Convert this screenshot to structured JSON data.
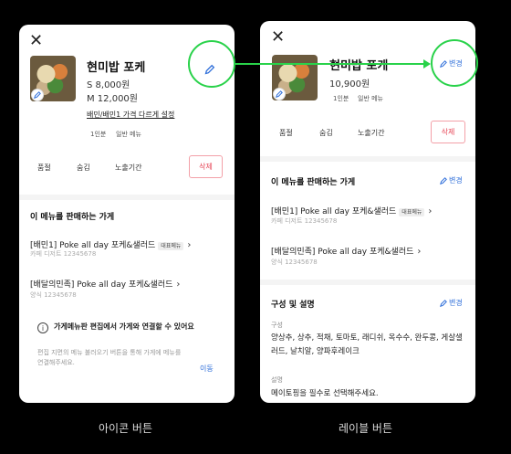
{
  "colors": {
    "background": "#000000",
    "highlight": "#29d24a",
    "delete_accent": "#e64556",
    "edit_blue": "#2b6cd9"
  },
  "left_screen": {
    "close_icon": "✕",
    "menu_name": "현미밥 포케",
    "price_small": "S  8,000원",
    "price_medium": "M  12,000원",
    "price_link": "배민/배민1 가격 다르게 설정",
    "tags": [
      "1인분",
      "일반 메뉴"
    ],
    "tabs": [
      "품절",
      "숨김",
      "노출기간"
    ],
    "delete_label": "삭제",
    "stores_section_title": "이 메뉴를 판매하는 가게",
    "stores": [
      {
        "name": "[배민1] Poke all day 포케&샐러드",
        "badge": "대표메뉴",
        "sub": "카페 디저트 12345678"
      },
      {
        "name": "[배달의민족] Poke all day 포케&샐러드",
        "badge": "",
        "sub": "양식 12345678"
      }
    ],
    "info_title": "가게메뉴판 편집에서 가게와 연결할 수 있어요",
    "info_desc": "편집 지면의 메뉴 불러오기 버튼을 통해 가게에 메뉴를 연결해주세요.",
    "info_link": "이동",
    "edit_icon_name": "pencil-icon"
  },
  "right_screen": {
    "close_icon": "✕",
    "menu_name": "현미밥 포케",
    "price": "10,900원",
    "tags": [
      "1인분",
      "일반 메뉴"
    ],
    "edit_label": "변경",
    "tabs": [
      "품절",
      "숨김",
      "노출기간"
    ],
    "delete_label": "삭제",
    "stores_section_title": "이 메뉴를 판매하는 가게",
    "stores_edit_label": "변경",
    "stores": [
      {
        "name": "[배민1] Poke all day 포케&샐러드",
        "badge": "대표메뉴",
        "sub": "카페 디저트 12345678"
      },
      {
        "name": "[배달의민족] Poke all day 포케&샐러드",
        "badge": "",
        "sub": "양식 12345678"
      }
    ],
    "composition_title": "구성 및 설명",
    "composition_edit_label": "변경",
    "composition_label": "구성",
    "composition_text": "양상추, 상추, 적채, 토마토, 래디쉬, 옥수수, 완두콩, 게살샐러드, 날치알, 양파후레이크",
    "description_label": "설명",
    "description_text": "메이토핑을 필수로 선택해주세요."
  },
  "captions": {
    "left": "아이콘 버튼",
    "right": "레이블 버튼"
  }
}
